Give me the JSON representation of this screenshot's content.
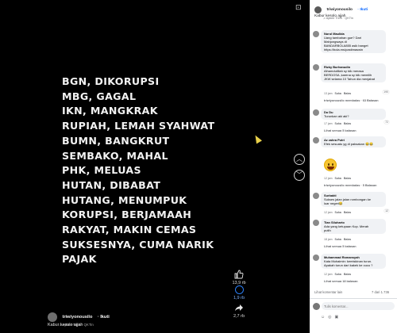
{
  "video": {
    "lines": [
      "BGN, DIKORUPSI",
      "MBG, GAGAL",
      "IKN, MANGKRAK",
      "RUPIAH, LEMAH SYAHWAT",
      "BUMN, BANGKRUT",
      "SEMBAKO, MAHAL",
      "PHK, MELUAS",
      "HUTAN, DIBABAT",
      "HUTANG, MENUMPUK",
      "KORUPSI, BERJAMAAH",
      "RAKYAT, MAKIN CEMAS",
      "SUKSESNYA, CUMA NARIK",
      "PAJAK"
    ],
    "nav_up_icon": "chevron-up-icon",
    "nav_down_icon": "chevron-down-icon"
  },
  "actions": {
    "like_count": "13,9 rb",
    "comment_count": "1,9 rb",
    "share_count": "2,7 rb"
  },
  "author": {
    "name": "triwiyonousilo",
    "follow": "· Ikuti",
    "sub": "♫ Aybee Trein · QKTin",
    "caption": "Kabur kesolo ajjah"
  },
  "panel": {
    "name": "triwiyonousilo",
    "follow": "· Ikuti",
    "sub": "♫ Aybee Trein · QKTin",
    "caption": "Kabur kesolo ajjah"
  },
  "comments": [
    {
      "name": "Nurul Maulida",
      "text": "Uang tambahan gue? Dari\nMahjongways di\nBANDARBOLA855 asik banget\nhttps://bola.ms/pastimaswin"
    },
    {
      "name": "Rizky Burhanudin",
      "text": "Alhamdulillah sy tdk merasa\nBERDOSA ,karena sy tdk memilih\nJKW selama 10 Tahun dia menjabat",
      "meta_time": "13 jam",
      "meta_like": "Suka",
      "meta_reply": "Balas",
      "react": "190",
      "replies": "triwiyonousilo membalas · 63 Balasan"
    },
    {
      "name": "Du Du",
      "text": "Turunkan aki aki?",
      "meta_time": "17 jam",
      "meta_like": "Suka",
      "meta_reply": "Balas",
      "react": "72",
      "replies": "Lihat semua 5 balasan"
    },
    {
      "name": "Az zahra Putri",
      "text": "Efek sesuatu yg di paksakan 😂😂",
      "meta_time": "12 jam",
      "meta_like": "Suka",
      "meta_reply": "Balas",
      "react": "",
      "replies": "triwiyonousilo membalas · 5 Balasan"
    },
    {
      "name": "Surbakti",
      "text": "Sukses jalan jalan rombongan ke\nluar negeri😂",
      "meta_time": "12 jam",
      "meta_like": "Suka",
      "meta_reply": "Balas",
      "react": "12"
    },
    {
      "name": "Tian Siluharto",
      "text": "Ada yang ketupaan Kop. Merah\nputih",
      "meta_time": "18 jam",
      "meta_like": "Suka",
      "meta_reply": "Balas",
      "react": "",
      "replies": "Lihat semua 5 balasan"
    },
    {
      "name": "Muhammad Romansyah",
      "text": "Kata Muhaimin: kemiskinan turun.\nApakah turun dari kakek ke cucu ?",
      "meta_time": "12 jam",
      "meta_like": "Suka",
      "meta_reply": "Balas",
      "react": "",
      "replies": "Lihat semua 18 balasan"
    }
  ],
  "footer": {
    "more_comments": "Lihat komentar lain",
    "comment_count": "7 dari 1.736",
    "input_placeholder": "Tulis komentar..."
  }
}
